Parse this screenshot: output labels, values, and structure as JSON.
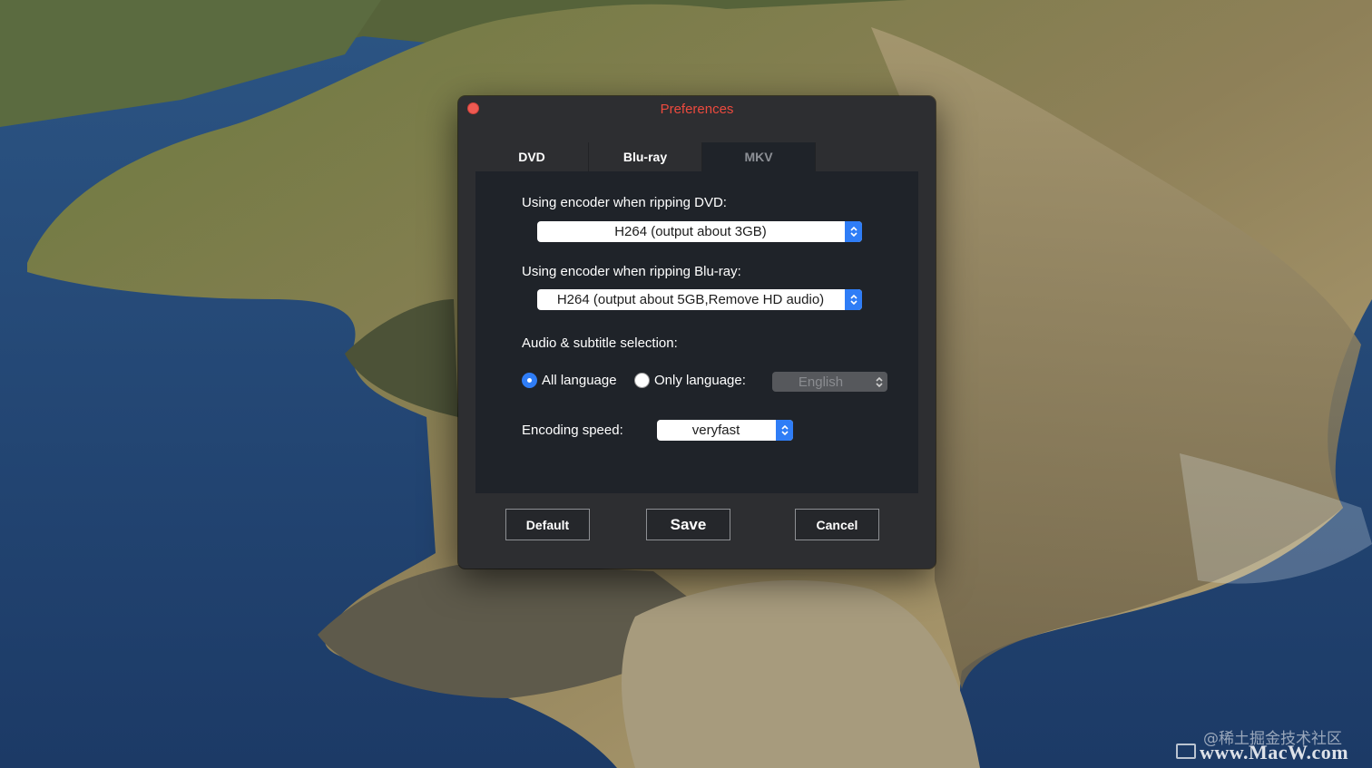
{
  "window": {
    "title": "Preferences",
    "title_color": "#ec4a3e",
    "close_color": "#ee5a52"
  },
  "tabs": [
    {
      "label": "DVD",
      "active": false
    },
    {
      "label": "Blu-ray",
      "active": false
    },
    {
      "label": "MKV",
      "active": true
    }
  ],
  "settings": {
    "dvd_encoder_label": "Using encoder when ripping DVD:",
    "dvd_encoder_value": "H264 (output about 3GB)",
    "bluray_encoder_label": "Using encoder when ripping Blu-ray:",
    "bluray_encoder_value": "H264 (output about 5GB,Remove HD audio)",
    "audio_subtitle_label": "Audio & subtitle selection:",
    "all_language_label": "All language",
    "all_language_selected": true,
    "only_language_label": "Only language:",
    "only_language_selected": false,
    "language_value": "English",
    "encoding_speed_label": "Encoding speed:",
    "encoding_speed_value": "veryfast"
  },
  "buttons": {
    "default_label": "Default",
    "save_label": "Save",
    "cancel_label": "Cancel"
  },
  "watermark": {
    "community": "@稀土掘金技术社区",
    "site": "www.MacW.com"
  },
  "colors": {
    "accent": "#2f7df6",
    "panel_bg": "#1f2329",
    "window_bg": "#2d2e31"
  }
}
